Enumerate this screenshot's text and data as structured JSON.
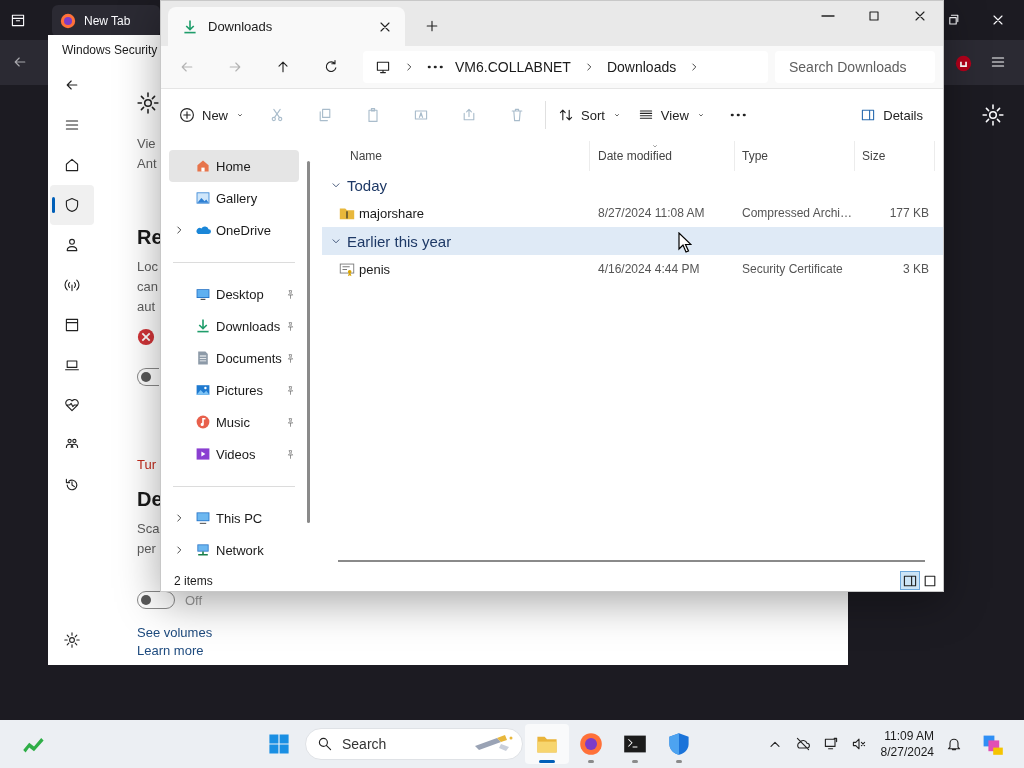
{
  "browser": {
    "tab": {
      "title": "New Tab",
      "selected": false
    }
  },
  "security": {
    "title": "Windows Security",
    "nav": [
      {
        "kind": "back",
        "selected": false
      },
      {
        "kind": "menu",
        "selected": false
      },
      {
        "kind": "home",
        "selected": false
      },
      {
        "kind": "shield",
        "selected": true
      },
      {
        "kind": "person",
        "selected": false
      },
      {
        "kind": "antenna",
        "selected": false
      },
      {
        "kind": "window",
        "selected": false
      },
      {
        "kind": "laptop",
        "selected": false
      },
      {
        "kind": "heart",
        "selected": false
      },
      {
        "kind": "family",
        "selected": false
      },
      {
        "kind": "history",
        "selected": false
      }
    ],
    "footer_nav": [
      {
        "kind": "gear",
        "selected": false
      }
    ],
    "intro": [
      "Vie",
      "Ant"
    ],
    "section_1": {
      "heading": "Re",
      "body": [
        "Loc",
        "can",
        "aut"
      ],
      "error": true,
      "toggle": {
        "on": false
      }
    },
    "link_1": "Tur",
    "section_2": {
      "heading": "De",
      "body": [
        "Sca",
        "per"
      ],
      "toggle": {
        "on": false,
        "label": "Off"
      }
    },
    "links": [
      "See volumes",
      "Learn more"
    ]
  },
  "explorer": {
    "tab": {
      "title": "Downloads"
    },
    "nav_buttons": [
      {
        "kind": "back",
        "disabled": true
      },
      {
        "kind": "forward",
        "disabled": true
      },
      {
        "kind": "up",
        "disabled": false
      },
      {
        "kind": "refresh",
        "disabled": false
      }
    ],
    "breadcrumb": [
      "VM6.COLLABNET",
      "Downloads"
    ],
    "search": {
      "placeholder": "Search Downloads"
    },
    "toolbar": [
      {
        "kind": "new",
        "label": "New",
        "disabled": false,
        "dropdown": true
      },
      {
        "kind": "cut",
        "disabled": true,
        "dropdown": false
      },
      {
        "kind": "copy",
        "disabled": true,
        "dropdown": false
      },
      {
        "kind": "paste",
        "disabled": true,
        "dropdown": false
      },
      {
        "kind": "rename",
        "disabled": true,
        "dropdown": false
      },
      {
        "kind": "share",
        "disabled": true,
        "dropdown": false
      },
      {
        "kind": "delete",
        "disabled": true,
        "dropdown": false
      },
      {
        "kind": "sort",
        "label": "Sort",
        "disabled": false,
        "dropdown": true
      },
      {
        "kind": "view",
        "label": "View",
        "disabled": false,
        "dropdown": true
      },
      {
        "kind": "more",
        "disabled": false,
        "dropdown": false
      }
    ],
    "details": "Details",
    "nav_pane": [
      [
        {
          "label": "Home",
          "kind": "home",
          "selected": true,
          "expandable": false,
          "pinned": false
        },
        {
          "label": "Gallery",
          "kind": "gallery",
          "selected": false,
          "expandable": false,
          "pinned": false
        },
        {
          "label": "OneDrive",
          "kind": "onedrive",
          "selected": false,
          "expandable": true,
          "pinned": false
        }
      ],
      [
        {
          "label": "Desktop",
          "kind": "desktop",
          "selected": false,
          "expandable": false,
          "pinned": true
        },
        {
          "label": "Downloads",
          "kind": "downloads",
          "selected": false,
          "expandable": false,
          "pinned": true
        },
        {
          "label": "Documents",
          "kind": "documents",
          "selected": false,
          "expandable": false,
          "pinned": true
        },
        {
          "label": "Pictures",
          "kind": "pictures",
          "selected": false,
          "expandable": false,
          "pinned": true
        },
        {
          "label": "Music",
          "kind": "music",
          "selected": false,
          "expandable": false,
          "pinned": true
        },
        {
          "label": "Videos",
          "kind": "videos",
          "selected": false,
          "expandable": false,
          "pinned": true
        }
      ],
      [
        {
          "label": "This PC",
          "kind": "thispc",
          "selected": false,
          "expandable": true,
          "pinned": false
        },
        {
          "label": "Network",
          "kind": "network",
          "selected": false,
          "expandable": true,
          "pinned": false
        }
      ]
    ],
    "columns": [
      {
        "label": "Name",
        "sorted": false
      },
      {
        "label": "Date modified",
        "sorted": true
      },
      {
        "label": "Type",
        "sorted": false
      },
      {
        "label": "Size",
        "sorted": false
      }
    ],
    "groups": [
      {
        "label": "Today",
        "expanded": true,
        "selected": false,
        "files": [
          {
            "name": "majorshare",
            "kind": "zip",
            "date": "8/27/2024 11:08 AM",
            "type": "Compressed Archi…",
            "size": "177 KB"
          }
        ]
      },
      {
        "label": "Earlier this year",
        "expanded": true,
        "selected": true,
        "files": [
          {
            "name": "penis",
            "kind": "certificate",
            "date": "4/16/2024 4:44 PM",
            "type": "Security Certificate",
            "size": "3 KB"
          }
        ]
      }
    ],
    "status": "2 items",
    "views": [
      {
        "kind": "details",
        "selected": true
      },
      {
        "kind": "tiles",
        "selected": false
      }
    ]
  },
  "taskbar": {
    "search": {
      "placeholder": "Search"
    },
    "apps": [
      {
        "kind": "explorer",
        "active": true,
        "running": true
      },
      {
        "kind": "firefox",
        "active": false,
        "running": true
      },
      {
        "kind": "terminal",
        "active": false,
        "running": true
      },
      {
        "kind": "defender",
        "active": false,
        "running": true
      }
    ],
    "time": "11:09 AM",
    "date": "8/27/2024"
  }
}
